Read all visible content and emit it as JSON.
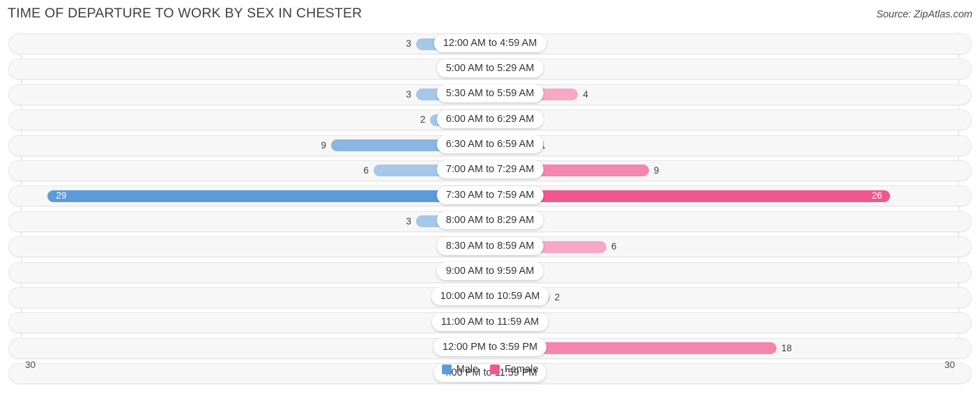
{
  "header": {
    "title": "TIME OF DEPARTURE TO WORK BY SEX IN CHESTER",
    "source": "Source: ZipAtlas.com"
  },
  "axis": {
    "left_tick": "30",
    "right_tick": "30"
  },
  "legend": {
    "items": [
      {
        "label": "Male",
        "color": "#5b9bd9"
      },
      {
        "label": "Female",
        "color": "#f0578f"
      }
    ]
  },
  "colors": {
    "male_light": "#a7c7e8",
    "male_mid": "#8ab6e2",
    "male_strong": "#5b9bd9",
    "female_light": "#f7a8c4",
    "female_mid": "#f486ae",
    "female_strong": "#f0578f",
    "track_bg": "#f7f7f7",
    "grid": "#d9d9d9"
  },
  "chart_data": {
    "type": "bar",
    "orientation": "horizontal-diverging",
    "title": "TIME OF DEPARTURE TO WORK BY SEX IN CHESTER",
    "xlabel": "",
    "ylabel": "",
    "xlim": [
      30,
      30
    ],
    "grid": true,
    "legend_position": "bottom-center",
    "categories": [
      "12:00 AM to 4:59 AM",
      "5:00 AM to 5:29 AM",
      "5:30 AM to 5:59 AM",
      "6:00 AM to 6:29 AM",
      "6:30 AM to 6:59 AM",
      "7:00 AM to 7:29 AM",
      "7:30 AM to 7:59 AM",
      "8:00 AM to 8:29 AM",
      "8:30 AM to 8:59 AM",
      "9:00 AM to 9:59 AM",
      "10:00 AM to 10:59 AM",
      "11:00 AM to 11:59 AM",
      "12:00 PM to 3:59 PM",
      "4:00 PM to 11:59 PM"
    ],
    "series": [
      {
        "name": "Male",
        "values": [
          3,
          0,
          3,
          2,
          9,
          6,
          29,
          3,
          0,
          0,
          0,
          0,
          0,
          0
        ]
      },
      {
        "name": "Female",
        "values": [
          1,
          0,
          4,
          0,
          1,
          9,
          26,
          0,
          6,
          0,
          2,
          0,
          18,
          0
        ]
      }
    ]
  }
}
